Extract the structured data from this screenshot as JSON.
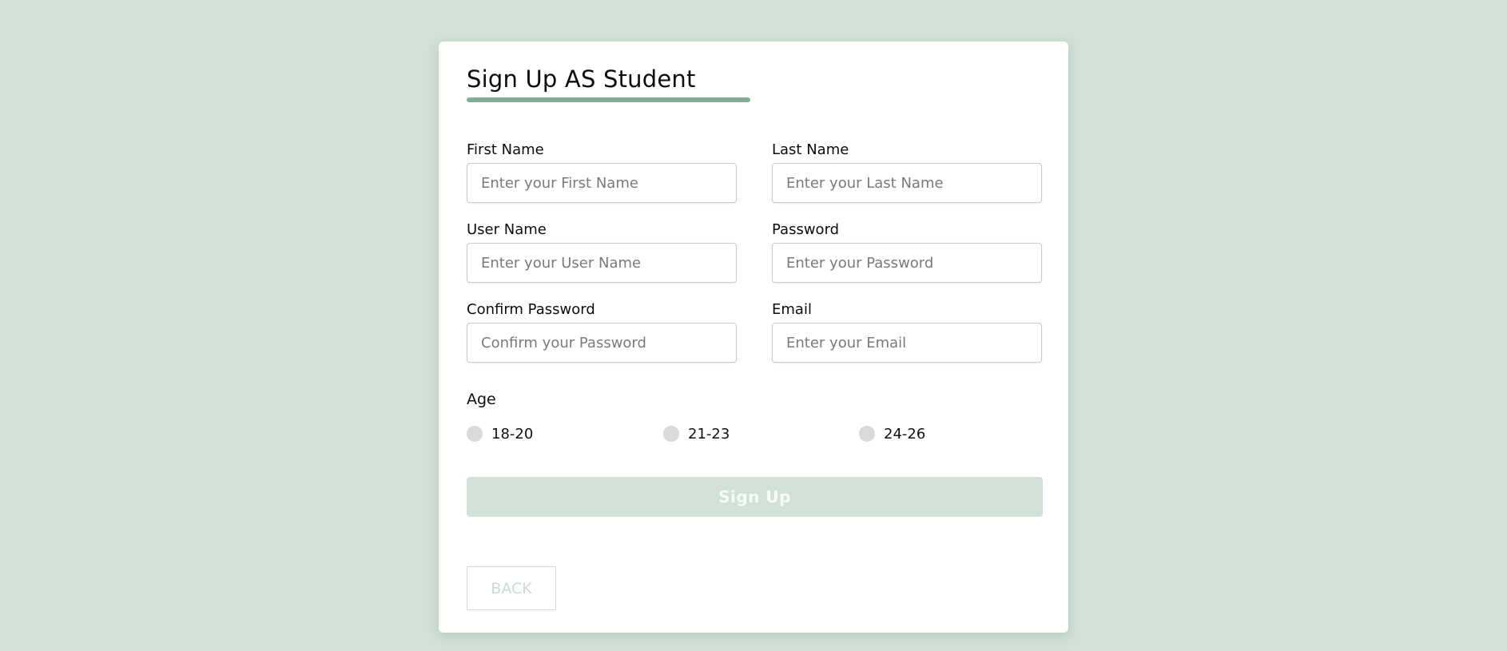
{
  "form": {
    "title": "Sign Up AS Student",
    "fields": [
      {
        "label": "First Name",
        "placeholder": "Enter your First Name",
        "value": ""
      },
      {
        "label": "Last Name",
        "placeholder": "Enter your Last Name",
        "value": ""
      },
      {
        "label": "User Name",
        "placeholder": "Enter your User Name",
        "value": ""
      },
      {
        "label": "Password",
        "placeholder": "Enter your Password",
        "value": ""
      },
      {
        "label": "Confirm Password",
        "placeholder": "Confirm your Password",
        "value": ""
      },
      {
        "label": "Email",
        "placeholder": "Enter your Email",
        "value": ""
      }
    ],
    "age": {
      "label": "Age",
      "options": [
        "18-20",
        "21-23",
        "24-26"
      ],
      "selected": null
    },
    "submit_label": "Sign Up",
    "back_label": "BACK"
  },
  "colors": {
    "page_background": "#d1e1d7",
    "accent": "#82ad94",
    "card_background": "#ffffff",
    "radio_unselected": "#d9d9d9"
  }
}
